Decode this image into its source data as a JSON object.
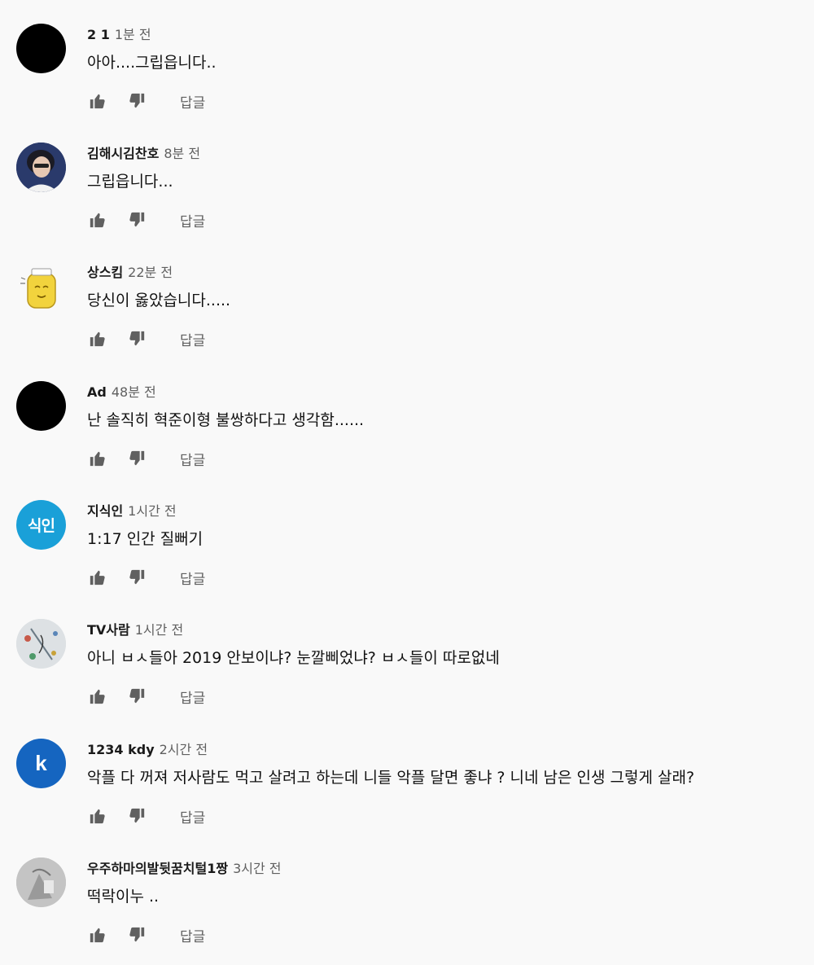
{
  "comments": [
    {
      "author": "2 1",
      "time": "1분 전",
      "text": "아아....그립읍니다..",
      "reply_label": "답글",
      "avatar": {
        "style": "black",
        "letter": "",
        "icon": "black-circle-avatar",
        "color": "#000000"
      }
    },
    {
      "author": "김해시김찬호",
      "time": "8분 전",
      "text": "그립읍니다...",
      "reply_label": "답글",
      "avatar": {
        "style": "photo",
        "letter": "",
        "icon": "person-photo-avatar",
        "color": "#2a3a6b"
      }
    },
    {
      "author": "상스킴",
      "time": "22분 전",
      "text": "당신이 옳았습니다.....",
      "reply_label": "답글",
      "avatar": {
        "style": "cartoon",
        "letter": "",
        "icon": "yellow-jar-character-avatar",
        "color": "#f2d33d"
      }
    },
    {
      "author": "Ad",
      "time": "48분 전",
      "text": "난 솔직히 혁준이형 불쌍하다고 생각함......",
      "reply_label": "답글",
      "avatar": {
        "style": "black",
        "letter": "",
        "icon": "black-circle-avatar",
        "color": "#000000"
      }
    },
    {
      "author": "지식인",
      "time": "1시간 전",
      "text": "1:17 인간 질뻐기",
      "reply_label": "답글",
      "avatar": {
        "style": "text",
        "letter": "식인",
        "icon": "text-avatar",
        "color": "#1aa0d8"
      }
    },
    {
      "author": "TV사람",
      "time": "1시간 전",
      "text": "아니 ㅂㅅ들아 2019 안보이냐? 눈깔삐었냐? ㅂㅅ들이 따로없네",
      "reply_label": "답글",
      "avatar": {
        "style": "drawing",
        "letter": "",
        "icon": "sketch-avatar",
        "color": "#d9dde0"
      }
    },
    {
      "author": "1234 kdy",
      "time": "2시간 전",
      "text": "악플 다 꺼져 저사람도 먹고 살려고 하는데 니들 악플 달면 좋냐 ? 니네 남은 인생 그렇게 살래?",
      "reply_label": "답글",
      "avatar": {
        "style": "letter",
        "letter": "k",
        "icon": "letter-avatar",
        "color": "#1565c0"
      }
    },
    {
      "author": "우주하마의발뒷꿈치털1짱",
      "time": "3시간 전",
      "text": "떡락이누 ..",
      "reply_label": "답글",
      "avatar": {
        "style": "gray",
        "letter": "",
        "icon": "gray-photo-avatar",
        "color": "#bdbdbd"
      }
    }
  ]
}
